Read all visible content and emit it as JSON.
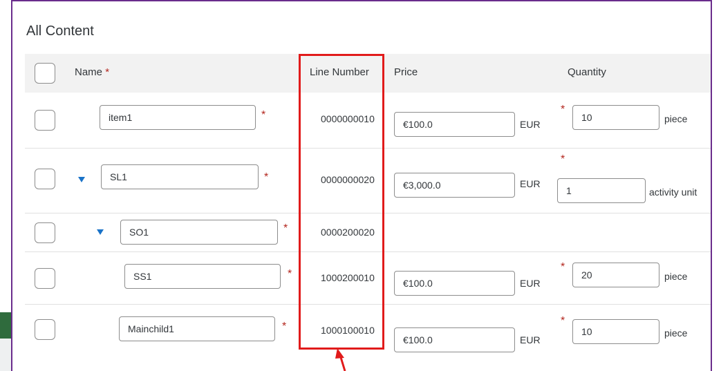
{
  "section": {
    "title": "All Content"
  },
  "columns": {
    "name": "Name",
    "line_number": "Line Number",
    "price": "Price",
    "quantity": "Quantity"
  },
  "required_mark": "*",
  "rows": [
    {
      "name": "item1",
      "line_number": "0000000010",
      "price": "€100.0",
      "currency": "EUR",
      "quantity": "10",
      "unit": "piece",
      "expandable": false
    },
    {
      "name": "SL1",
      "line_number": "0000000020",
      "price": "€3,000.0",
      "currency": "EUR",
      "quantity": "1",
      "unit": "activity unit",
      "expandable": true
    },
    {
      "name": "SO1",
      "line_number": "0000200020",
      "expandable": true
    },
    {
      "name": "SS1",
      "line_number": "1000200010",
      "price": "€100.0",
      "currency": "EUR",
      "quantity": "20",
      "unit": "piece",
      "expandable": false
    },
    {
      "name": "Mainchild1",
      "line_number": "1000100010",
      "price": "€100.0",
      "currency": "EUR",
      "quantity": "10",
      "unit": "piece",
      "expandable": false
    }
  ],
  "annotation": {
    "highlight_color": "#e11b1b",
    "frame_color": "#6a2c8c"
  }
}
